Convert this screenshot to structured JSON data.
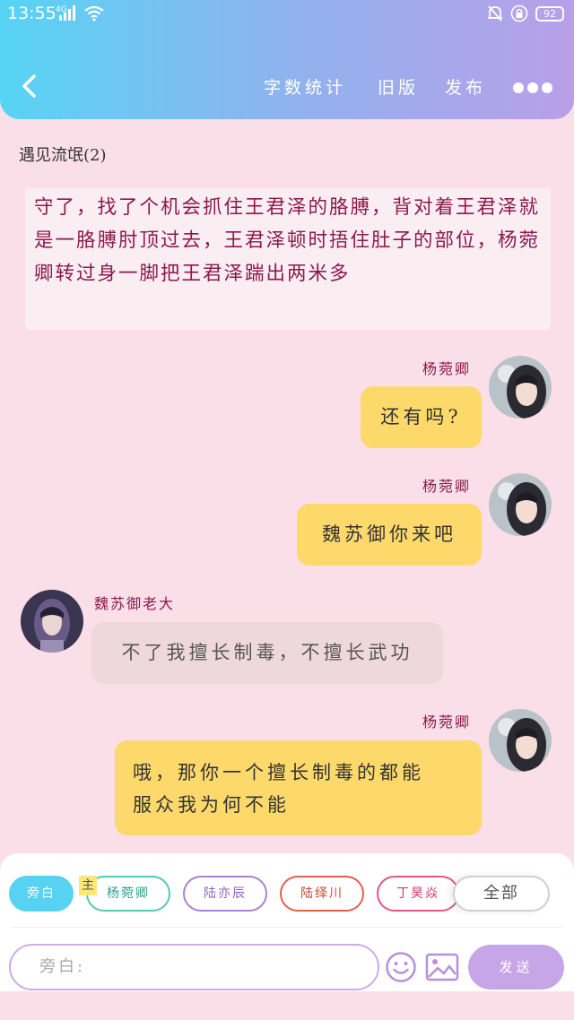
{
  "status_bar": {
    "time": "13:55",
    "network": "4G",
    "battery": "92"
  },
  "header": {
    "word_count_label": "字数统计",
    "old_version_label": "旧版",
    "publish_label": "发布"
  },
  "chapter_title": "遇见流氓(2)",
  "narration": "守了，找了个机会抓住王君泽的胳膊，背对着王君泽就是一胳膊肘顶过去，王君泽顿时捂住肚子的部位，杨菀卿转过身一脚把王君泽踹出两米多",
  "messages": [
    {
      "sender": "杨菀卿",
      "text": "还有吗?",
      "side": "right"
    },
    {
      "sender": "杨菀卿",
      "text": "魏苏御你来吧",
      "side": "right"
    },
    {
      "sender": "魏苏御老大",
      "text": "不了我擅长制毒，不擅长武功",
      "side": "left"
    },
    {
      "sender": "杨菀卿",
      "lines": [
        "哦，那你一个擅长制毒的都能",
        "服众我为何不能"
      ],
      "side": "right"
    }
  ],
  "character_bar": {
    "narrator_label": "旁白",
    "main_tag": "主",
    "chips": [
      "杨菀卿",
      "陆亦辰",
      "陆绎川",
      "丁昊焱"
    ],
    "all_label": "全部"
  },
  "input": {
    "placeholder": "旁白:"
  },
  "send_label": "发送",
  "colors": {
    "background": "#fadfe8",
    "my_bubble": "#fdd96c",
    "other_bubble": "#efd8dc",
    "name_color": "#8c1a4a",
    "accent": "#c6a6e6"
  }
}
